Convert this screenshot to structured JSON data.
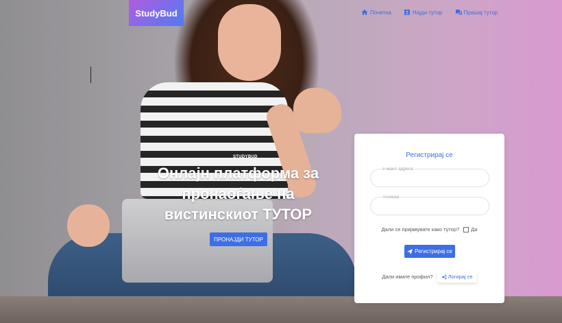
{
  "brand": {
    "logo_text": "StudyBud"
  },
  "nav": {
    "items": [
      {
        "label": "Почетна",
        "icon": "home-icon"
      },
      {
        "label": "Најди тутор",
        "icon": "user-box-icon"
      },
      {
        "label": "Прашај тутор",
        "icon": "chat-icon"
      }
    ]
  },
  "hero": {
    "eyebrow": "STUDYBUD",
    "title": "Онлајн платформа за пронаоѓање на вистинскиот ТУТОР",
    "button": "ПРОНАЈДИ ТУТОР"
  },
  "register": {
    "title": "Регистрирај се",
    "email_placeholder": "е-маил адреса",
    "password_placeholder": "лозинка",
    "tutor_question": "Дали се пријавувате како тутор?",
    "tutor_checkbox_label": "Да",
    "submit": "Регистрирај се",
    "profile_question": "Дали имате профил?",
    "login": "Логирај се"
  },
  "colors": {
    "accent": "#3d6ee6",
    "logo_gradient_start": "#b05ce0",
    "logo_gradient_end": "#4f7cf2"
  }
}
